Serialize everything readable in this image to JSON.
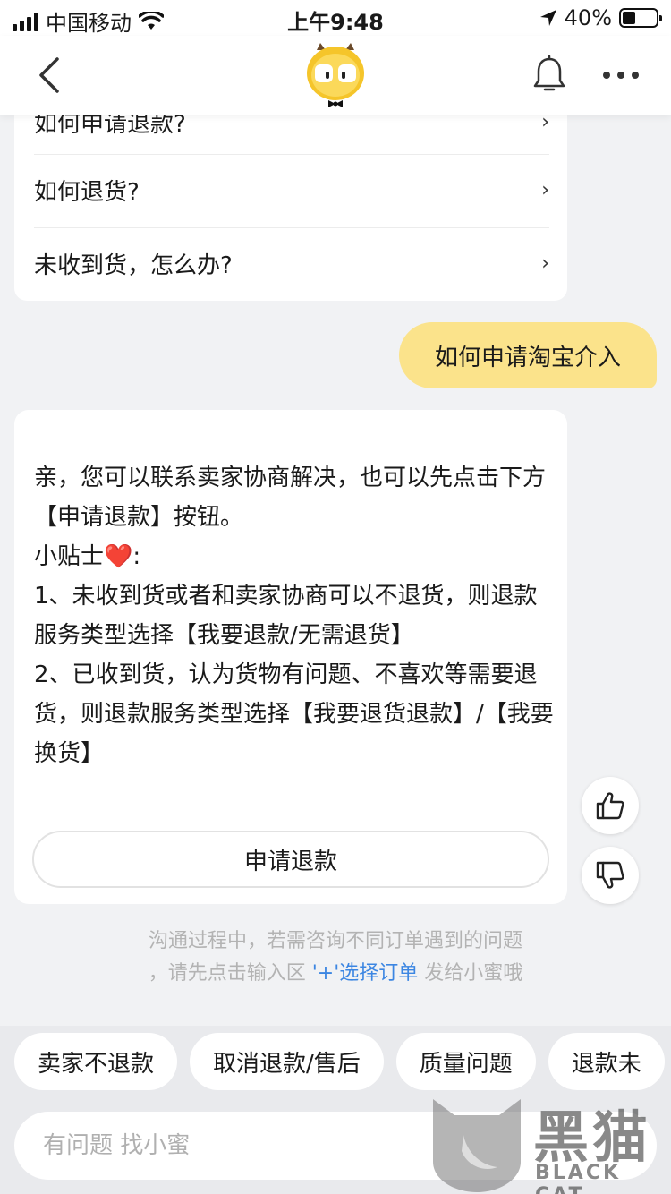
{
  "status_bar": {
    "carrier": "中国移动",
    "time": "上午9:48",
    "battery": "40%",
    "battery_level": 0.4
  },
  "nav": {
    "back_icon": "chevron-left-icon",
    "avatar_icon": "xiaomi-mascot",
    "bell_icon": "bell-icon",
    "more_icon": "more-dots-icon"
  },
  "faq": {
    "items": [
      {
        "label": "如何申请退款?",
        "arrow": "›"
      },
      {
        "label": "如何退货?",
        "arrow": "›"
      },
      {
        "label": "未收到货，怎么办?",
        "arrow": "›"
      }
    ]
  },
  "user_message": "如何申请淘宝介入",
  "answer": {
    "line1": "亲，您可以联系卖家协商解决，也可以先点击下方【申请退款】按钮。",
    "tip_label": "小贴士",
    "tip_emoji": "❤️",
    "tip_colon": ":",
    "point1": "1、未收到货或者和卖家协商可以不退货，则退款服务类型选择【我要退款/无需退货】",
    "point2": "2、已收到货，认为货物有问题、不喜欢等需要退货，则退款服务类型选择【我要退货退款】/【我要换货】",
    "button": "申请退款"
  },
  "feedback": {
    "like_icon": "thumbs-up-icon",
    "dislike_icon": "thumbs-down-icon"
  },
  "notice": {
    "line1": "沟通过程中，若需咨询不同订单遇到的问题",
    "line2_prefix": "，请先点击输入区",
    "line2_link": "'+'选择订单",
    "line2_suffix": "发给小蜜哦"
  },
  "quick_replies": [
    "卖家不退款",
    "取消退款/售后",
    "质量问题",
    "退款未"
  ],
  "input": {
    "placeholder": "有问题 找小蜜"
  },
  "watermark": {
    "cn": "黑猫",
    "en": "BLACK CAT"
  },
  "colors": {
    "user_bubble": "#fbe38b",
    "link": "#3c86e2",
    "background": "#f1f2f4"
  }
}
